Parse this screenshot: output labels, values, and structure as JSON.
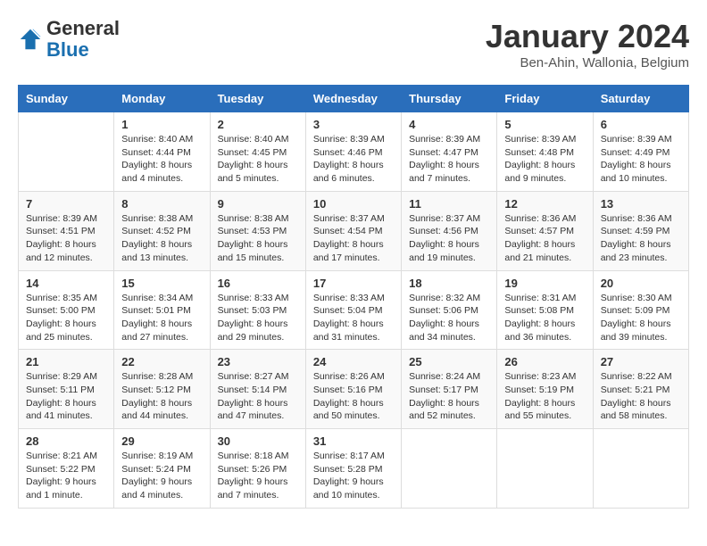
{
  "logo": {
    "general": "General",
    "blue": "Blue"
  },
  "header": {
    "month": "January 2024",
    "location": "Ben-Ahin, Wallonia, Belgium"
  },
  "days_of_week": [
    "Sunday",
    "Monday",
    "Tuesday",
    "Wednesday",
    "Thursday",
    "Friday",
    "Saturday"
  ],
  "weeks": [
    [
      {
        "day": "",
        "info": ""
      },
      {
        "day": "1",
        "info": "Sunrise: 8:40 AM\nSunset: 4:44 PM\nDaylight: 8 hours\nand 4 minutes."
      },
      {
        "day": "2",
        "info": "Sunrise: 8:40 AM\nSunset: 4:45 PM\nDaylight: 8 hours\nand 5 minutes."
      },
      {
        "day": "3",
        "info": "Sunrise: 8:39 AM\nSunset: 4:46 PM\nDaylight: 8 hours\nand 6 minutes."
      },
      {
        "day": "4",
        "info": "Sunrise: 8:39 AM\nSunset: 4:47 PM\nDaylight: 8 hours\nand 7 minutes."
      },
      {
        "day": "5",
        "info": "Sunrise: 8:39 AM\nSunset: 4:48 PM\nDaylight: 8 hours\nand 9 minutes."
      },
      {
        "day": "6",
        "info": "Sunrise: 8:39 AM\nSunset: 4:49 PM\nDaylight: 8 hours\nand 10 minutes."
      }
    ],
    [
      {
        "day": "7",
        "info": "Sunrise: 8:39 AM\nSunset: 4:51 PM\nDaylight: 8 hours\nand 12 minutes."
      },
      {
        "day": "8",
        "info": "Sunrise: 8:38 AM\nSunset: 4:52 PM\nDaylight: 8 hours\nand 13 minutes."
      },
      {
        "day": "9",
        "info": "Sunrise: 8:38 AM\nSunset: 4:53 PM\nDaylight: 8 hours\nand 15 minutes."
      },
      {
        "day": "10",
        "info": "Sunrise: 8:37 AM\nSunset: 4:54 PM\nDaylight: 8 hours\nand 17 minutes."
      },
      {
        "day": "11",
        "info": "Sunrise: 8:37 AM\nSunset: 4:56 PM\nDaylight: 8 hours\nand 19 minutes."
      },
      {
        "day": "12",
        "info": "Sunrise: 8:36 AM\nSunset: 4:57 PM\nDaylight: 8 hours\nand 21 minutes."
      },
      {
        "day": "13",
        "info": "Sunrise: 8:36 AM\nSunset: 4:59 PM\nDaylight: 8 hours\nand 23 minutes."
      }
    ],
    [
      {
        "day": "14",
        "info": "Sunrise: 8:35 AM\nSunset: 5:00 PM\nDaylight: 8 hours\nand 25 minutes."
      },
      {
        "day": "15",
        "info": "Sunrise: 8:34 AM\nSunset: 5:01 PM\nDaylight: 8 hours\nand 27 minutes."
      },
      {
        "day": "16",
        "info": "Sunrise: 8:33 AM\nSunset: 5:03 PM\nDaylight: 8 hours\nand 29 minutes."
      },
      {
        "day": "17",
        "info": "Sunrise: 8:33 AM\nSunset: 5:04 PM\nDaylight: 8 hours\nand 31 minutes."
      },
      {
        "day": "18",
        "info": "Sunrise: 8:32 AM\nSunset: 5:06 PM\nDaylight: 8 hours\nand 34 minutes."
      },
      {
        "day": "19",
        "info": "Sunrise: 8:31 AM\nSunset: 5:08 PM\nDaylight: 8 hours\nand 36 minutes."
      },
      {
        "day": "20",
        "info": "Sunrise: 8:30 AM\nSunset: 5:09 PM\nDaylight: 8 hours\nand 39 minutes."
      }
    ],
    [
      {
        "day": "21",
        "info": "Sunrise: 8:29 AM\nSunset: 5:11 PM\nDaylight: 8 hours\nand 41 minutes."
      },
      {
        "day": "22",
        "info": "Sunrise: 8:28 AM\nSunset: 5:12 PM\nDaylight: 8 hours\nand 44 minutes."
      },
      {
        "day": "23",
        "info": "Sunrise: 8:27 AM\nSunset: 5:14 PM\nDaylight: 8 hours\nand 47 minutes."
      },
      {
        "day": "24",
        "info": "Sunrise: 8:26 AM\nSunset: 5:16 PM\nDaylight: 8 hours\nand 50 minutes."
      },
      {
        "day": "25",
        "info": "Sunrise: 8:24 AM\nSunset: 5:17 PM\nDaylight: 8 hours\nand 52 minutes."
      },
      {
        "day": "26",
        "info": "Sunrise: 8:23 AM\nSunset: 5:19 PM\nDaylight: 8 hours\nand 55 minutes."
      },
      {
        "day": "27",
        "info": "Sunrise: 8:22 AM\nSunset: 5:21 PM\nDaylight: 8 hours\nand 58 minutes."
      }
    ],
    [
      {
        "day": "28",
        "info": "Sunrise: 8:21 AM\nSunset: 5:22 PM\nDaylight: 9 hours\nand 1 minute."
      },
      {
        "day": "29",
        "info": "Sunrise: 8:19 AM\nSunset: 5:24 PM\nDaylight: 9 hours\nand 4 minutes."
      },
      {
        "day": "30",
        "info": "Sunrise: 8:18 AM\nSunset: 5:26 PM\nDaylight: 9 hours\nand 7 minutes."
      },
      {
        "day": "31",
        "info": "Sunrise: 8:17 AM\nSunset: 5:28 PM\nDaylight: 9 hours\nand 10 minutes."
      },
      {
        "day": "",
        "info": ""
      },
      {
        "day": "",
        "info": ""
      },
      {
        "day": "",
        "info": ""
      }
    ]
  ]
}
